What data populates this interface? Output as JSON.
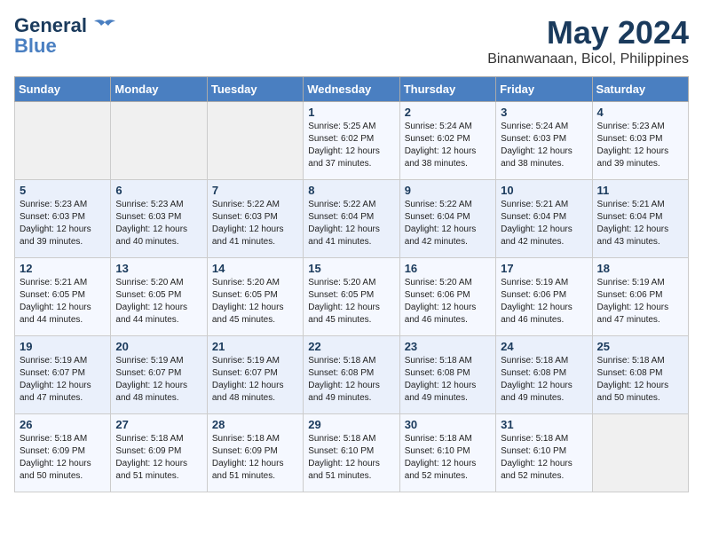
{
  "header": {
    "logo_line1": "General",
    "logo_line2": "Blue",
    "month": "May 2024",
    "location": "Binanwanaan, Bicol, Philippines"
  },
  "days_of_week": [
    "Sunday",
    "Monday",
    "Tuesday",
    "Wednesday",
    "Thursday",
    "Friday",
    "Saturday"
  ],
  "weeks": [
    [
      {
        "day": "",
        "info": ""
      },
      {
        "day": "",
        "info": ""
      },
      {
        "day": "",
        "info": ""
      },
      {
        "day": "1",
        "info": "Sunrise: 5:25 AM\nSunset: 6:02 PM\nDaylight: 12 hours\nand 37 minutes."
      },
      {
        "day": "2",
        "info": "Sunrise: 5:24 AM\nSunset: 6:02 PM\nDaylight: 12 hours\nand 38 minutes."
      },
      {
        "day": "3",
        "info": "Sunrise: 5:24 AM\nSunset: 6:03 PM\nDaylight: 12 hours\nand 38 minutes."
      },
      {
        "day": "4",
        "info": "Sunrise: 5:23 AM\nSunset: 6:03 PM\nDaylight: 12 hours\nand 39 minutes."
      }
    ],
    [
      {
        "day": "5",
        "info": "Sunrise: 5:23 AM\nSunset: 6:03 PM\nDaylight: 12 hours\nand 39 minutes."
      },
      {
        "day": "6",
        "info": "Sunrise: 5:23 AM\nSunset: 6:03 PM\nDaylight: 12 hours\nand 40 minutes."
      },
      {
        "day": "7",
        "info": "Sunrise: 5:22 AM\nSunset: 6:03 PM\nDaylight: 12 hours\nand 41 minutes."
      },
      {
        "day": "8",
        "info": "Sunrise: 5:22 AM\nSunset: 6:04 PM\nDaylight: 12 hours\nand 41 minutes."
      },
      {
        "day": "9",
        "info": "Sunrise: 5:22 AM\nSunset: 6:04 PM\nDaylight: 12 hours\nand 42 minutes."
      },
      {
        "day": "10",
        "info": "Sunrise: 5:21 AM\nSunset: 6:04 PM\nDaylight: 12 hours\nand 42 minutes."
      },
      {
        "day": "11",
        "info": "Sunrise: 5:21 AM\nSunset: 6:04 PM\nDaylight: 12 hours\nand 43 minutes."
      }
    ],
    [
      {
        "day": "12",
        "info": "Sunrise: 5:21 AM\nSunset: 6:05 PM\nDaylight: 12 hours\nand 44 minutes."
      },
      {
        "day": "13",
        "info": "Sunrise: 5:20 AM\nSunset: 6:05 PM\nDaylight: 12 hours\nand 44 minutes."
      },
      {
        "day": "14",
        "info": "Sunrise: 5:20 AM\nSunset: 6:05 PM\nDaylight: 12 hours\nand 45 minutes."
      },
      {
        "day": "15",
        "info": "Sunrise: 5:20 AM\nSunset: 6:05 PM\nDaylight: 12 hours\nand 45 minutes."
      },
      {
        "day": "16",
        "info": "Sunrise: 5:20 AM\nSunset: 6:06 PM\nDaylight: 12 hours\nand 46 minutes."
      },
      {
        "day": "17",
        "info": "Sunrise: 5:19 AM\nSunset: 6:06 PM\nDaylight: 12 hours\nand 46 minutes."
      },
      {
        "day": "18",
        "info": "Sunrise: 5:19 AM\nSunset: 6:06 PM\nDaylight: 12 hours\nand 47 minutes."
      }
    ],
    [
      {
        "day": "19",
        "info": "Sunrise: 5:19 AM\nSunset: 6:07 PM\nDaylight: 12 hours\nand 47 minutes."
      },
      {
        "day": "20",
        "info": "Sunrise: 5:19 AM\nSunset: 6:07 PM\nDaylight: 12 hours\nand 48 minutes."
      },
      {
        "day": "21",
        "info": "Sunrise: 5:19 AM\nSunset: 6:07 PM\nDaylight: 12 hours\nand 48 minutes."
      },
      {
        "day": "22",
        "info": "Sunrise: 5:18 AM\nSunset: 6:08 PM\nDaylight: 12 hours\nand 49 minutes."
      },
      {
        "day": "23",
        "info": "Sunrise: 5:18 AM\nSunset: 6:08 PM\nDaylight: 12 hours\nand 49 minutes."
      },
      {
        "day": "24",
        "info": "Sunrise: 5:18 AM\nSunset: 6:08 PM\nDaylight: 12 hours\nand 49 minutes."
      },
      {
        "day": "25",
        "info": "Sunrise: 5:18 AM\nSunset: 6:08 PM\nDaylight: 12 hours\nand 50 minutes."
      }
    ],
    [
      {
        "day": "26",
        "info": "Sunrise: 5:18 AM\nSunset: 6:09 PM\nDaylight: 12 hours\nand 50 minutes."
      },
      {
        "day": "27",
        "info": "Sunrise: 5:18 AM\nSunset: 6:09 PM\nDaylight: 12 hours\nand 51 minutes."
      },
      {
        "day": "28",
        "info": "Sunrise: 5:18 AM\nSunset: 6:09 PM\nDaylight: 12 hours\nand 51 minutes."
      },
      {
        "day": "29",
        "info": "Sunrise: 5:18 AM\nSunset: 6:10 PM\nDaylight: 12 hours\nand 51 minutes."
      },
      {
        "day": "30",
        "info": "Sunrise: 5:18 AM\nSunset: 6:10 PM\nDaylight: 12 hours\nand 52 minutes."
      },
      {
        "day": "31",
        "info": "Sunrise: 5:18 AM\nSunset: 6:10 PM\nDaylight: 12 hours\nand 52 minutes."
      },
      {
        "day": "",
        "info": ""
      }
    ]
  ]
}
